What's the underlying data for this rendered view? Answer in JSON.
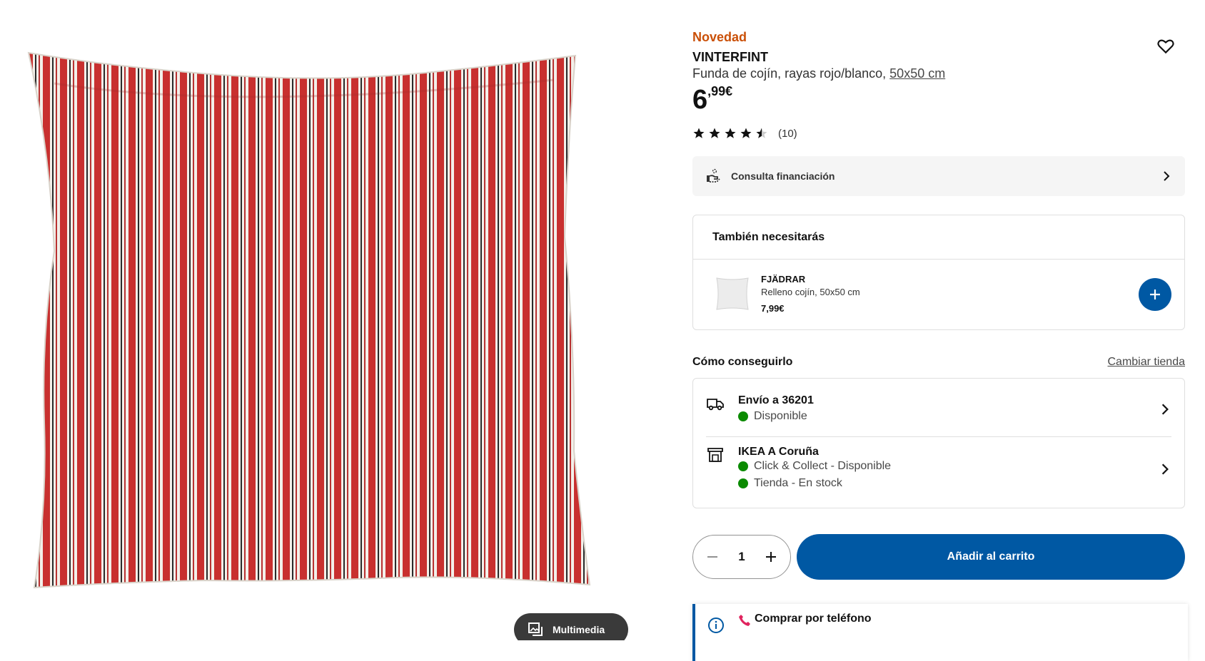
{
  "gallery": {
    "media_label": "Multimedia",
    "image_alt": "Cushion cover with red and white stripes"
  },
  "product": {
    "badge": "Novedad",
    "name": "VINTERFINT",
    "description": "Funda de cojín, rayas rojo/blanco, ",
    "size": "50x50 cm",
    "price_int": "6",
    "price_dec": ",99€",
    "rating_value": 4.5,
    "rating_count": "(10)"
  },
  "finance": {
    "label": "Consulta financiación"
  },
  "also_need": {
    "title": "También necesitarás",
    "item": {
      "name": "FJÄDRAR",
      "desc": "Relleno cojín, 50x50 cm",
      "price": "7,99€"
    }
  },
  "how": {
    "title": "Cómo conseguirlo",
    "change_store": "Cambiar tienda",
    "delivery": {
      "title": "Envío a 36201",
      "status": "Disponible"
    },
    "store": {
      "title": "IKEA A Coruña",
      "status1": "Click & Collect - Disponible",
      "status2": "Tienda - En stock"
    }
  },
  "purchase": {
    "quantity": "1",
    "cart_label": "Añadir al carrito"
  },
  "phone": {
    "title": "Comprar por teléfono"
  },
  "colors": {
    "accent": "#0058a3",
    "new": "#ca5008",
    "available": "#0a8a00"
  }
}
